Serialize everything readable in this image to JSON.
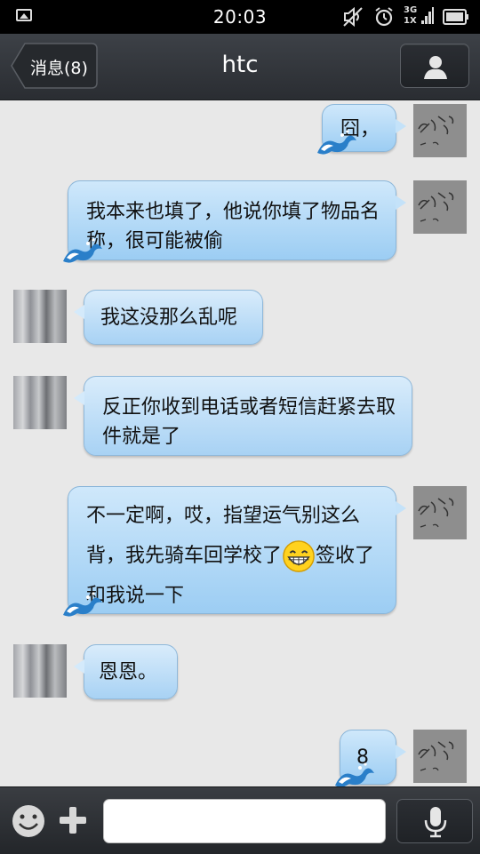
{
  "status_bar": {
    "time": "20:03",
    "network_top": "3G",
    "network_bottom": "1X"
  },
  "header": {
    "back_label": "消息(8)",
    "title": "htc"
  },
  "messages": [
    {
      "dir": "out",
      "text": "囧，"
    },
    {
      "dir": "out",
      "text": "我本来也填了，他说你填了物品名称，很可能被偷"
    },
    {
      "dir": "in",
      "text": "我这没那么乱呢"
    },
    {
      "dir": "in",
      "text": "反正你收到电话或者短信赶紧去取件就是了"
    },
    {
      "dir": "out",
      "text_before_emoji": "不一定啊，哎，指望运气别这么背，我先骑车回学校了",
      "emoji": "grinning-face",
      "text_after_emoji": "签收了和我说一下"
    },
    {
      "dir": "in",
      "text": "恩恩。"
    },
    {
      "dir": "out",
      "text": "8"
    }
  ],
  "composer": {
    "placeholder": ""
  },
  "colors": {
    "bubble_blue": "#a8d2f4",
    "header_dark": "#2a2d32",
    "chat_background": "#e8e8e8"
  },
  "icons": [
    "image-icon",
    "mute-icon",
    "alarm-icon",
    "signal-icon",
    "battery-icon",
    "profile-icon",
    "smiley-icon",
    "plus-icon",
    "microphone-icon"
  ]
}
